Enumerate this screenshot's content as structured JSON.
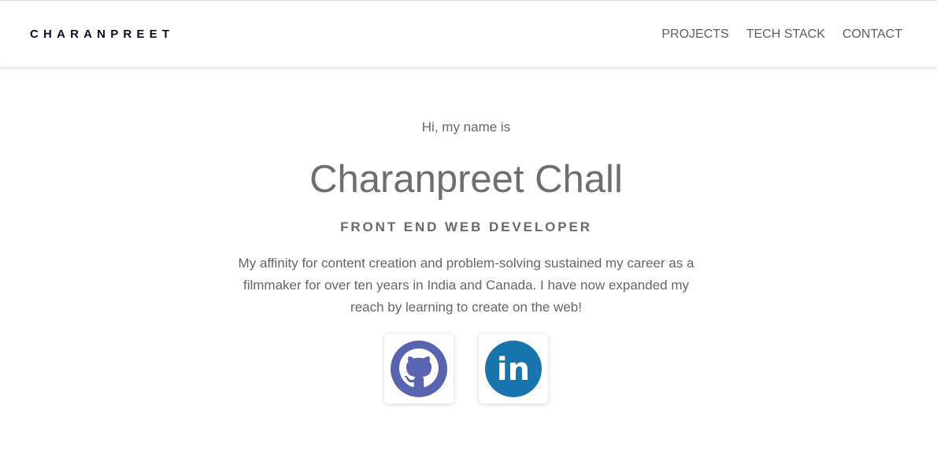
{
  "header": {
    "brand": "CHARANPREET",
    "nav": [
      {
        "label": "PROJECTS"
      },
      {
        "label": "TECH STACK"
      },
      {
        "label": "CONTACT"
      }
    ]
  },
  "hero": {
    "greeting": "Hi, my name is",
    "name": "Charanpreet Chall",
    "role": "FRONT END WEB DEVELOPER",
    "bio": "My affinity for content creation and problem-solving sustained my career as a filmmaker for over ten years in India and Canada. I have now expanded my reach by learning to create on the web!"
  },
  "social": {
    "github": {
      "icon": "github-icon",
      "color": "#5864b0"
    },
    "linkedin": {
      "icon": "linkedin-icon",
      "color": "#1874ac",
      "text": "in"
    }
  },
  "colors": {
    "brand": "#120a2a",
    "text": "#666666",
    "heading": "#6e6e6e"
  }
}
